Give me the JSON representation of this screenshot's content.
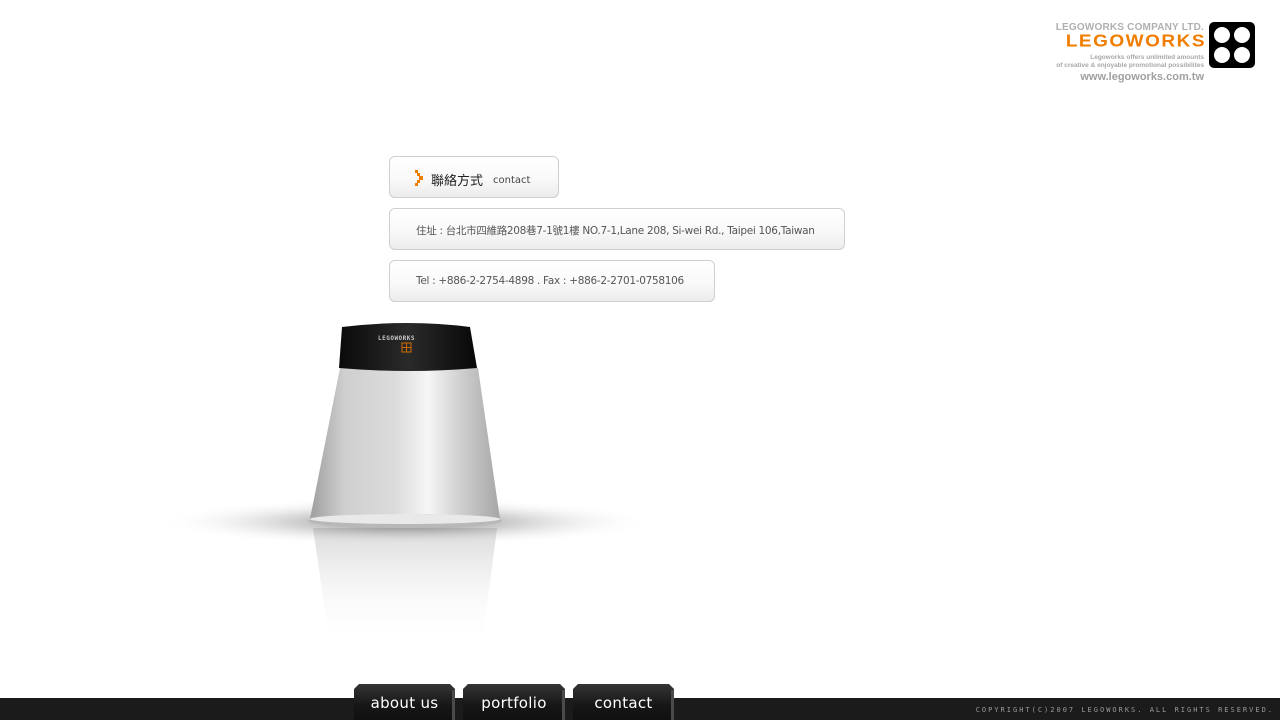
{
  "logo": {
    "company": "LEGOWORKS COMPANY LTD.",
    "wordmark": "LEGOWORKS",
    "tagline_1": "Legoworks offers unlimited amounts",
    "tagline_2": "of creative & enjoyable promotional possibilites",
    "url": "www.legoworks.com.tw"
  },
  "contact": {
    "title_zh": "聯絡方式",
    "title_en": "contact",
    "address": "住址 : 台北市四維路208巷7-1號1樓 NO.7-1,Lane 208, Si-wei Rd., Taipei 106,Taiwan",
    "phone_fax": "Tel : +886-2-2754-4898  .  Fax : +886-2-2701-0758106"
  },
  "product": {
    "label": "LEGOWORKS"
  },
  "nav": {
    "about": "about us",
    "portfolio": "portfolio",
    "contact": "contact"
  },
  "footer": {
    "copyright": "COPYRIGHT(C)2007 LEGOWORKS. ALL RIGHTS RESERVED."
  },
  "colors": {
    "accent": "#f07d00",
    "footer": "#1b1b1b",
    "tab": "#161616"
  }
}
